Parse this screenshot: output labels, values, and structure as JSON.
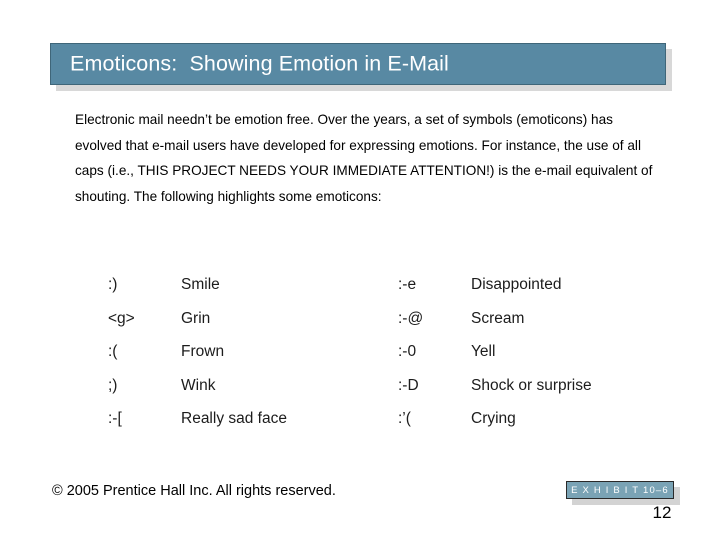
{
  "slide": {
    "title": "Emoticons:  Showing Emotion in E-Mail",
    "body": "Electronic mail needn’t be emotion free. Over the years, a set of symbols (emoticons) has evolved that e-mail users have developed for expressing emotions. For instance, the use of all caps (i.e., THIS PROJECT NEEDS YOUR IMMEDIATE ATTENTION!) is the e-mail equivalent of shouting. The following highlights some emoticons:",
    "emoticons": {
      "left": [
        {
          "symbol": ":)",
          "label": "Smile"
        },
        {
          "symbol": "<g>",
          "label": "Grin"
        },
        {
          "symbol": ":(",
          "label": "Frown"
        },
        {
          "symbol": ";)",
          "label": "Wink"
        },
        {
          "symbol": ":-[",
          "label": "Really sad face"
        }
      ],
      "right": [
        {
          "symbol": ":-e",
          "label": "Disappointed"
        },
        {
          "symbol": ":-@",
          "label": "Scream"
        },
        {
          "symbol": ":-0",
          "label": "Yell"
        },
        {
          "symbol": ":-D",
          "label": "Shock or surprise"
        },
        {
          "symbol": ":’(",
          "label": "Crying"
        }
      ]
    },
    "footer": {
      "copyright": "© 2005 Prentice Hall Inc. All rights reserved.",
      "exhibit_label": "E X H I B I T 10–6",
      "slide_number": "12"
    },
    "colors": {
      "title_bar": "#5889a3",
      "title_border": "#3f6679",
      "title_shadow": "#d8d8d8",
      "badge_fill": "#7aa3b5",
      "badge_border": "#2a2a2a",
      "text": "#000000",
      "background": "#ffffff"
    }
  }
}
